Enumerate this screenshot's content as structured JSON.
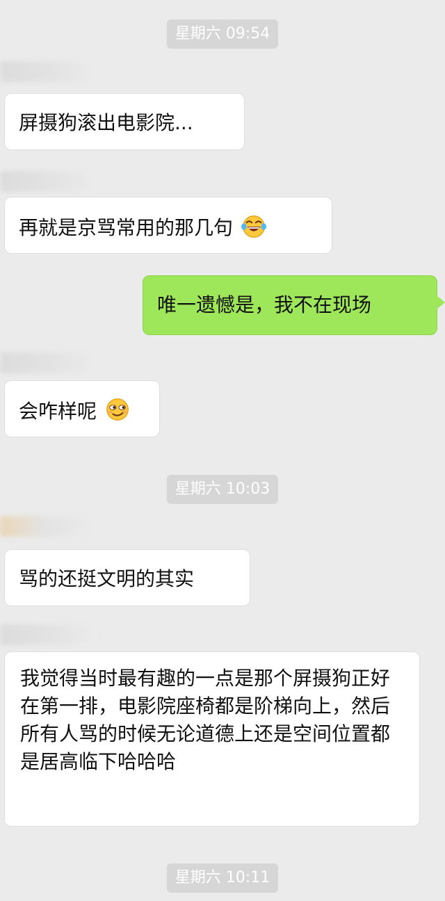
{
  "timestamps": [
    "星期六 09:54",
    "星期六 10:03",
    "星期六 10:11"
  ],
  "messages": [
    {
      "side": "left",
      "text": "屏摄狗滚出电影院..."
    },
    {
      "side": "left",
      "text": "再就是京骂常用的那几句",
      "emoji": "tears-of-joy-emoji-icon"
    },
    {
      "side": "right",
      "text": "唯一遗憾是，我不在现场"
    },
    {
      "side": "left",
      "text": "会咋样呢",
      "emoji": "smirk-emoji-icon"
    },
    {
      "side": "left",
      "text": "骂的还挺文明的其实"
    },
    {
      "side": "left",
      "text": "我觉得当时最有趣的一点是那个屏摄狗正好在第一排，电影院座椅都是阶梯向上，然后所有人骂的时候无论道德上还是空间位置都是居高临下哈哈哈"
    }
  ],
  "colors": {
    "background": "#ebebeb",
    "incoming_bubble": "#ffffff",
    "outgoing_bubble": "#9fe75a",
    "timestamp_pill": "#d6d6d6"
  }
}
